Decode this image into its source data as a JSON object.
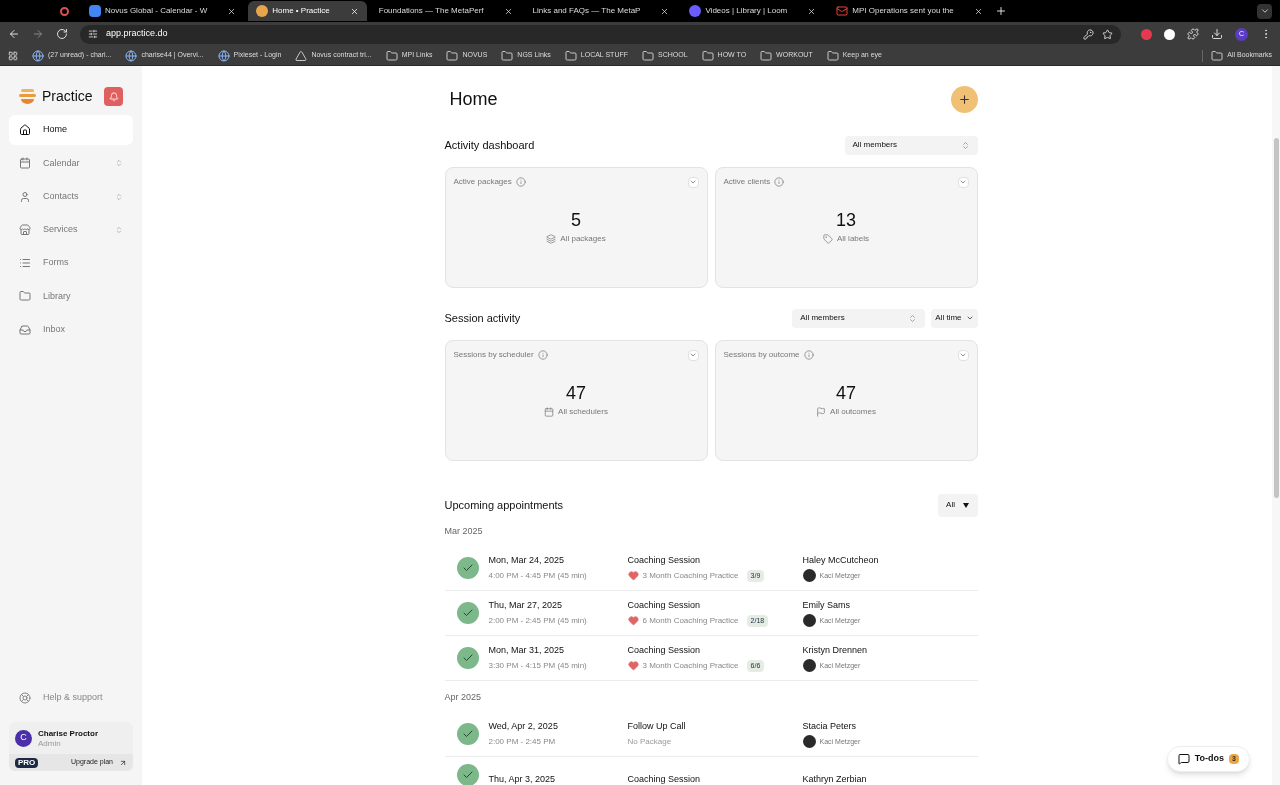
{
  "browser": {
    "tabs": [
      {
        "title": "Novus Global - Calendar - W",
        "selected": false,
        "kind": "calendar"
      },
      {
        "title": "Home • Practice",
        "selected": true,
        "kind": "practice"
      },
      {
        "title": "Foundations — The MetaPerf",
        "selected": false,
        "kind": "none"
      },
      {
        "title": "Links and FAQs — The MetaP",
        "selected": false,
        "kind": "none"
      },
      {
        "title": "Videos | Library | Loom",
        "selected": false,
        "kind": "loom"
      },
      {
        "title": "MPI Operations sent you the",
        "selected": false,
        "kind": "mail"
      }
    ],
    "url": "app.practice.do",
    "bookmarks": [
      {
        "label": "(27 unread) - chari...",
        "kind": "site"
      },
      {
        "label": "charise44 | Overvi...",
        "kind": "site"
      },
      {
        "label": "Pixieset - Login",
        "kind": "site"
      },
      {
        "label": "Novus contract tri...",
        "kind": "drive"
      },
      {
        "label": "MPI Links",
        "kind": "folder"
      },
      {
        "label": "NOVUS",
        "kind": "folder"
      },
      {
        "label": "NGS Links",
        "kind": "folder"
      },
      {
        "label": "LOCAL STUFF",
        "kind": "folder"
      },
      {
        "label": "SCHOOL",
        "kind": "folder"
      },
      {
        "label": "HOW TO",
        "kind": "folder"
      },
      {
        "label": "WORKOUT",
        "kind": "folder"
      },
      {
        "label": "Keep an eye",
        "kind": "folder"
      }
    ],
    "all_bookmarks": "All Bookmarks",
    "profile_initial": "C"
  },
  "sidebar": {
    "brand": "Practice",
    "items": [
      {
        "label": "Home",
        "kind": "home",
        "selected": true,
        "expandable": false
      },
      {
        "label": "Calendar",
        "kind": "calendar",
        "selected": false,
        "expandable": true
      },
      {
        "label": "Contacts",
        "kind": "contacts",
        "selected": false,
        "expandable": true
      },
      {
        "label": "Services",
        "kind": "services",
        "selected": false,
        "expandable": true
      },
      {
        "label": "Forms",
        "kind": "forms",
        "selected": false,
        "expandable": false
      },
      {
        "label": "Library",
        "kind": "library",
        "selected": false,
        "expandable": false
      },
      {
        "label": "Inbox",
        "kind": "inbox",
        "selected": false,
        "expandable": false
      }
    ],
    "help": "Help & support",
    "user": {
      "initial": "C",
      "name": "Charise Proctor",
      "role": "Admin"
    },
    "plan": {
      "badge": "PRO",
      "link": "Upgrade plan"
    }
  },
  "page": {
    "title": "Home",
    "activity": {
      "title": "Activity dashboard",
      "filters": [
        "All members"
      ],
      "cards": [
        {
          "title": "Active packages",
          "value": "5",
          "link": "All packages",
          "kind": "packages"
        },
        {
          "title": "Active clients",
          "value": "13",
          "link": "All labels",
          "kind": "labels"
        }
      ]
    },
    "sessions": {
      "title": "Session activity",
      "filters": [
        "All members",
        "All time"
      ],
      "cards": [
        {
          "title": "Sessions by scheduler",
          "value": "47",
          "link": "All schedulers",
          "kind": "schedulers"
        },
        {
          "title": "Sessions by outcome",
          "value": "47",
          "link": "All outcomes",
          "kind": "outcomes"
        }
      ]
    },
    "upcoming": {
      "title": "Upcoming appointments",
      "filter": "All",
      "groups": [
        {
          "month": "Mar 2025",
          "appointments": [
            {
              "done": true,
              "date": "Mon, Mar 24, 2025",
              "time": "4:00 PM - 4:45 PM (45 min)",
              "title": "Coaching Session",
              "package": {
                "kind": "package",
                "name": "3 Month Coaching Practice",
                "progress": "3/9"
              },
              "client": "Haley McCutcheon",
              "coach": "Kaci Metzger"
            },
            {
              "done": true,
              "date": "Thu, Mar 27, 2025",
              "time": "2:00 PM - 2:45 PM (45 min)",
              "title": "Coaching Session",
              "package": {
                "kind": "package",
                "name": "6 Month Coaching Practice",
                "progress": "2/18"
              },
              "client": "Emily Sams",
              "coach": "Kaci Metzger"
            },
            {
              "done": true,
              "date": "Mon, Mar 31, 2025",
              "time": "3:30 PM - 4:15 PM (45 min)",
              "title": "Coaching Session",
              "package": {
                "kind": "package",
                "name": "3 Month Coaching Practice",
                "progress": "6/6"
              },
              "client": "Kristyn Drennen",
              "coach": "Kaci Metzger"
            }
          ]
        },
        {
          "month": "Apr 2025",
          "appointments": [
            {
              "done": true,
              "date": "Wed, Apr 2, 2025",
              "time": "2:00 PM - 2:45 PM",
              "title": "Follow Up Call",
              "package": {
                "kind": "none",
                "name": "No Package"
              },
              "client": "Stacia Peters",
              "coach": "Kaci Metzger"
            },
            {
              "done": true,
              "date": "Thu, Apr 3, 2025",
              "title": "Coaching Session",
              "client": "Kathryn Zerbian"
            }
          ]
        }
      ]
    },
    "todos": {
      "label": "To-dos",
      "count": "3"
    }
  }
}
